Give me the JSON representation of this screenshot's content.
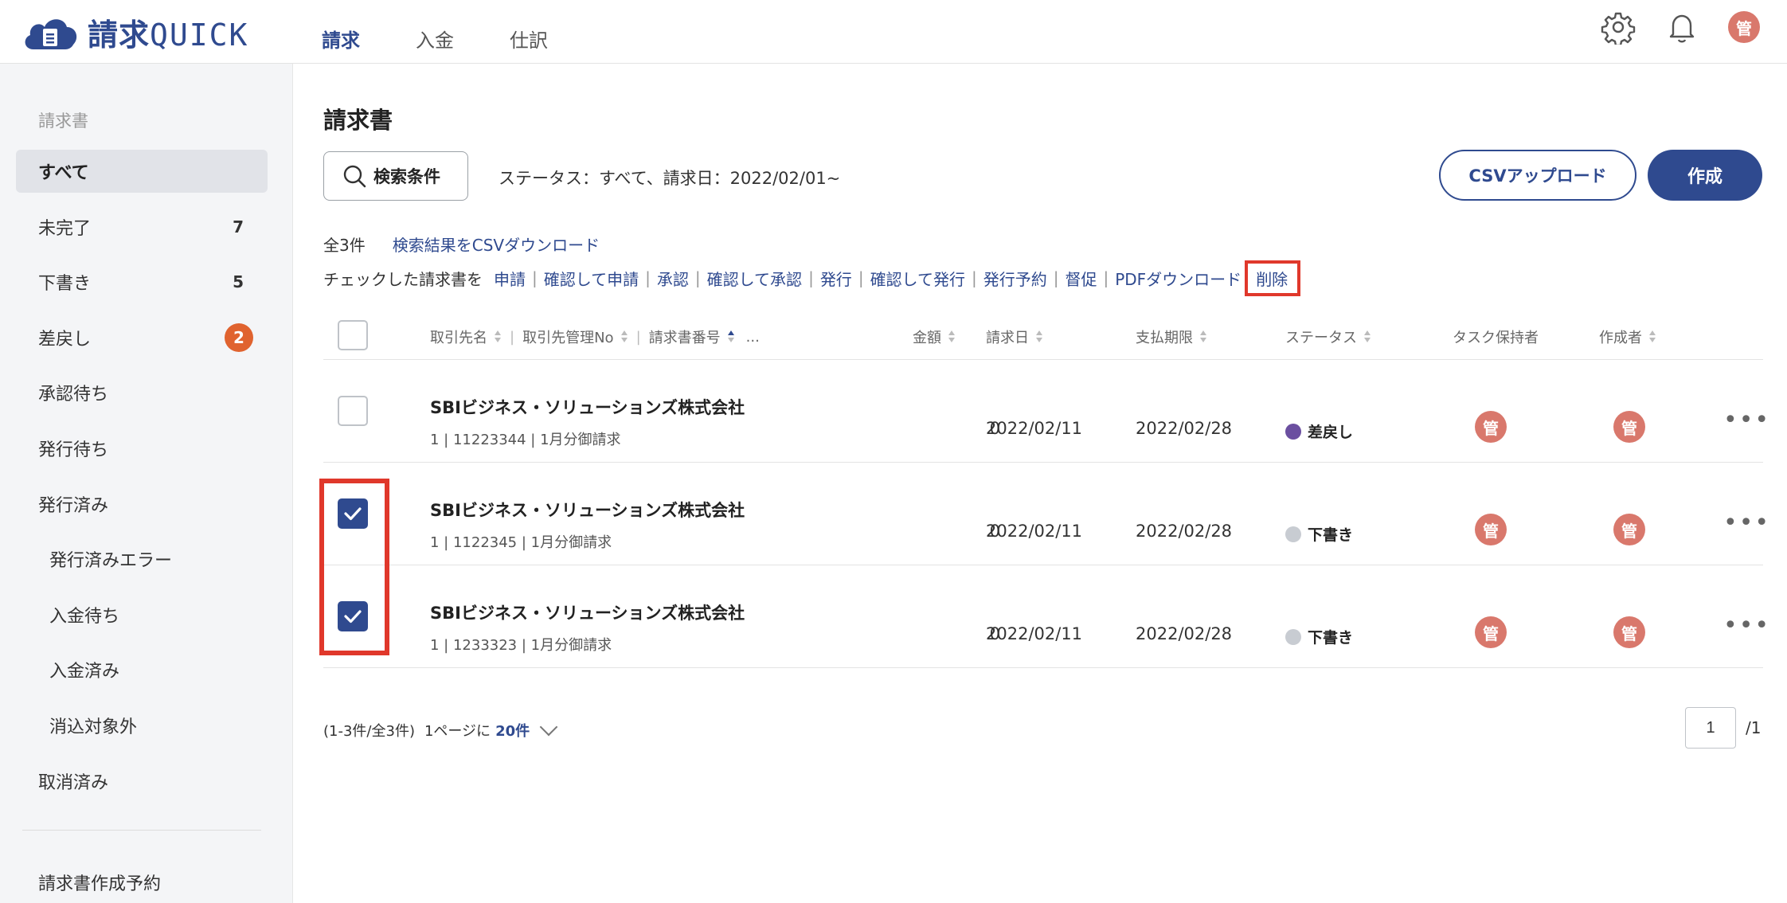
{
  "app": {
    "logo_main": "請求",
    "logo_sub": "QUICK",
    "nav_tabs": [
      {
        "label": "請求"
      },
      {
        "label": "入金"
      },
      {
        "label": "仕訳"
      }
    ],
    "user_avatar": "管"
  },
  "sidebar": {
    "section_label": "請求書",
    "items": [
      {
        "label": "すべて"
      },
      {
        "label": "未完了",
        "count": "7"
      },
      {
        "label": "下書き",
        "count": "5"
      },
      {
        "label": "差戻し",
        "badge": "2"
      },
      {
        "label": "承認待ち"
      },
      {
        "label": "発行待ち"
      },
      {
        "label": "発行済み"
      },
      {
        "label": "発行済みエラー"
      },
      {
        "label": "入金待ち"
      },
      {
        "label": "入金済み"
      },
      {
        "label": "消込対象外"
      },
      {
        "label": "取消済み"
      }
    ],
    "bottom_item": "請求書作成予約"
  },
  "main": {
    "title": "請求書",
    "search_button": "検索条件",
    "filter_summary": "ステータス：すべて、請求日：2022/02/01~",
    "csv_upload": "CSVアップロード",
    "create": "作成",
    "total": "全3件",
    "csv_download": "検索結果をCSVダウンロード",
    "bulk_label": "チェックした請求書を",
    "bulk_actions": [
      "申請",
      "確認して申請",
      "承認",
      "確認して承認",
      "発行",
      "確認して発行",
      "発行予約",
      "督促",
      "PDFダウンロード"
    ],
    "delete_action": "削除"
  },
  "table": {
    "headers": {
      "partner": "取引先名",
      "partner_no": "取引先管理No",
      "invoice_no": "請求書番号",
      "more": "...",
      "amount": "金額",
      "invoice_date": "請求日",
      "due_date": "支払期限",
      "status": "ステータス",
      "task_owner": "タスク保持者",
      "creator": "作成者"
    },
    "rows": [
      {
        "company": "SBIビジネス・ソリューションズ株式会社",
        "meta": "1 | 11223344 | 1月分御請求",
        "amount": "0",
        "invoice_date": "2022/02/11",
        "due_date": "2022/02/28",
        "status": "差戻し",
        "status_color": "#6b4fa0",
        "task_owner": "管",
        "creator": "管",
        "checked": false
      },
      {
        "company": "SBIビジネス・ソリューションズ株式会社",
        "meta": "1 | 1122345 | 1月分御請求",
        "amount": "0",
        "invoice_date": "2022/02/11",
        "due_date": "2022/02/28",
        "status": "下書き",
        "status_color": "#c8ccd2",
        "task_owner": "管",
        "creator": "管",
        "checked": true
      },
      {
        "company": "SBIビジネス・ソリューションズ株式会社",
        "meta": "1 | 1233323 | 1月分御請求",
        "amount": "0",
        "invoice_date": "2022/02/11",
        "due_date": "2022/02/28",
        "status": "下書き",
        "status_color": "#c8ccd2",
        "task_owner": "管",
        "creator": "管",
        "checked": true
      }
    ]
  },
  "pagination": {
    "range": "(1-3件/全3件)",
    "per_page_label": "1ページに",
    "per_page_value": "20件",
    "current_page": "1",
    "total_pages": "/1"
  },
  "colors": {
    "primary": "#2f4a8f",
    "badge": "#e0632f",
    "avatar": "#d9786c",
    "highlight": "#e0382b"
  }
}
